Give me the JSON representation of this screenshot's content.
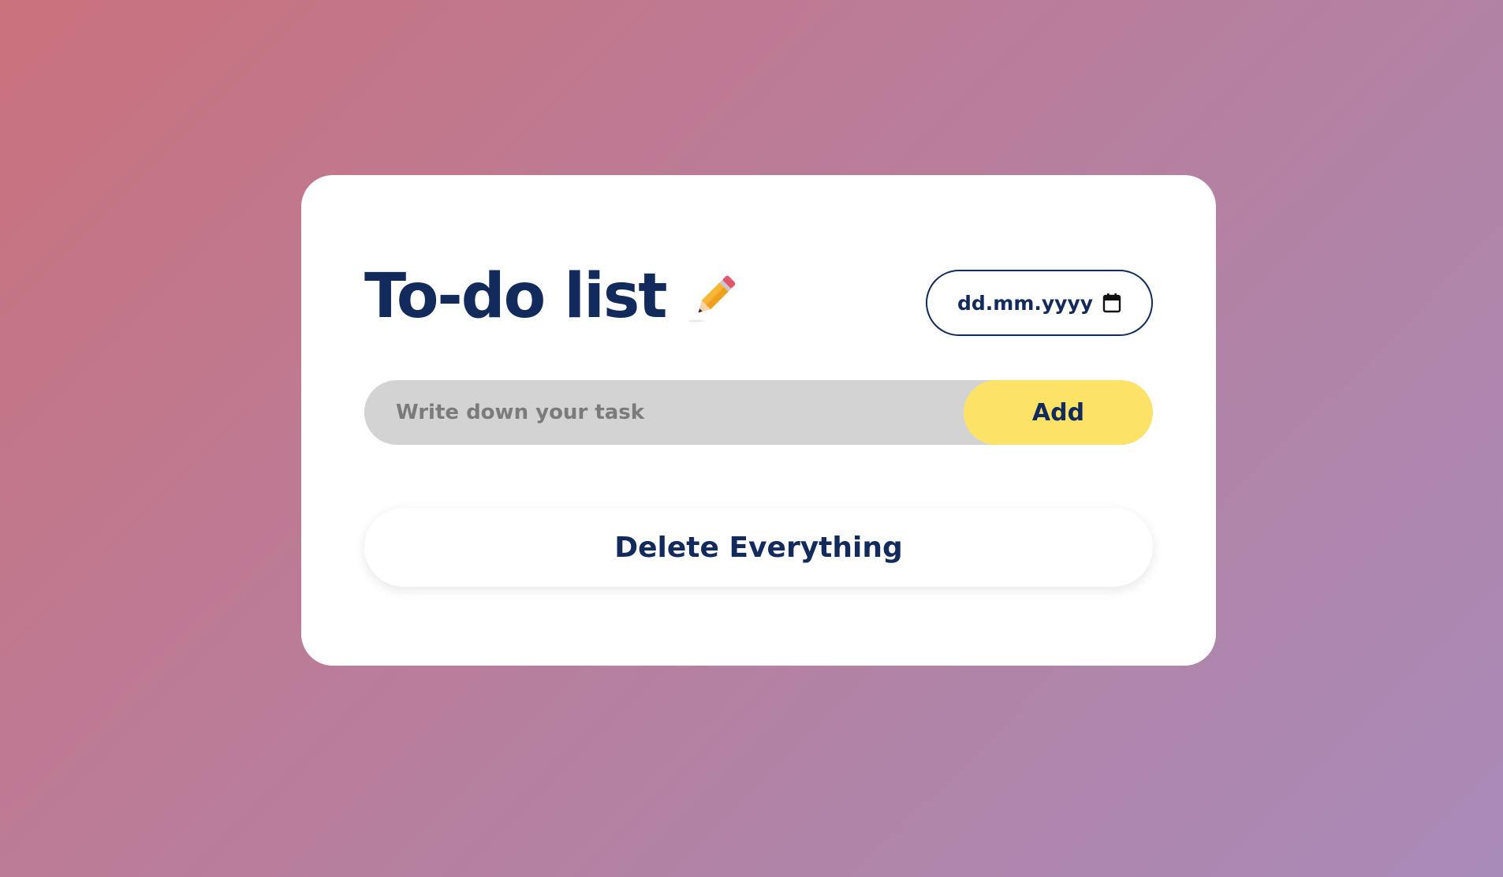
{
  "app": {
    "title": "To-do list",
    "title_icon": "pencil-icon"
  },
  "date_input": {
    "placeholder": "dd.mm.yyyy",
    "icon": "calendar-icon"
  },
  "task_input": {
    "placeholder": "Write down your task",
    "value": ""
  },
  "buttons": {
    "add_label": "Add",
    "delete_all_label": "Delete Everything"
  },
  "colors": {
    "primary_text": "#122a5c",
    "add_button_bg": "#fce368",
    "input_bg": "#d3d3d3",
    "card_bg": "#ffffff",
    "background_gradient_start": "#c9727c",
    "background_gradient_end": "#a98bb8"
  }
}
